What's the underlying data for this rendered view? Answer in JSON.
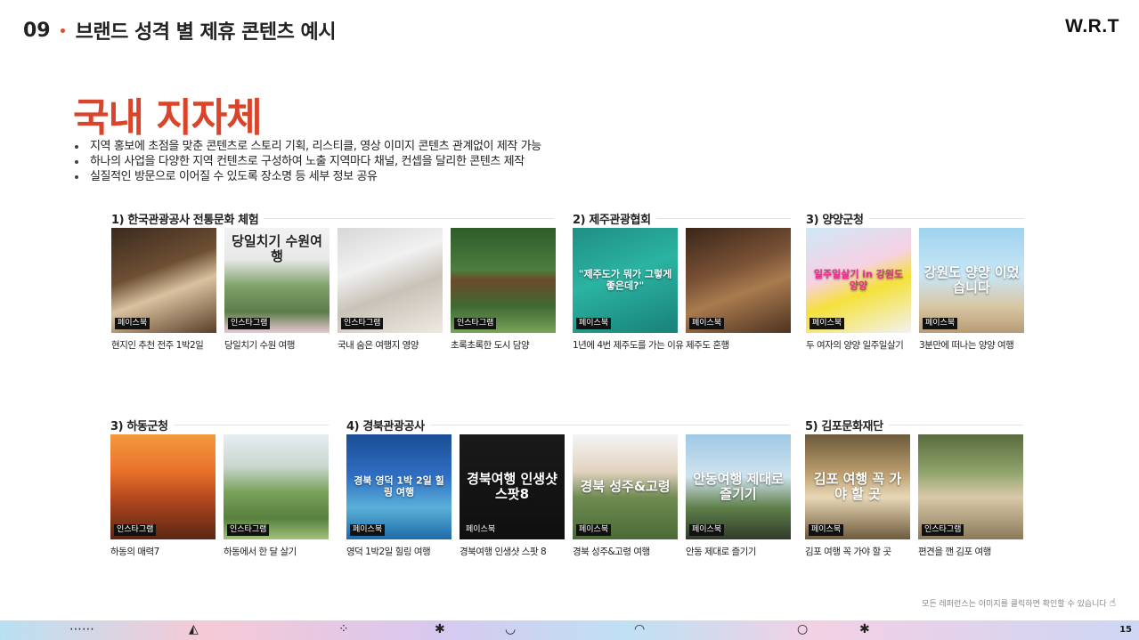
{
  "header": {
    "section_number": "09",
    "section_title": "브랜드 성격 별 제휴 콘텐츠 예시",
    "logo": "W.R.T"
  },
  "main_title": "국내 지자체",
  "bullets": [
    "지역 홍보에 초점을 맞춘 콘텐츠로 스토리 기획, 리스티클, 영상 이미지 콘텐츠 관계없이 제작 가능",
    "하나의 사업을 다양한 지역 컨텐츠로 구성하여 노출 지역마다 채널, 컨셉을 달리한 콘텐츠 제작",
    "실질적인 방문으로 이어질 수 있도록 장소명 등 세부 정보 공유"
  ],
  "groups": [
    {
      "label": "1) 한국관광공사 전통문화 체험",
      "cards": [
        {
          "platform": "페이스북",
          "caption": "현지인 추천 전주 1박2일",
          "overlay": "",
          "bg": "linear-gradient(160deg,#3b2a1e 0%,#6e4f34 40%,#d9c2a0 60%,#5a3e28 100%)"
        },
        {
          "platform": "인스타그램",
          "caption": "당일치기 수원 여행",
          "overlay": "당일치기 수원여행",
          "bg": "linear-gradient(180deg,#f2f2f2 0%,#e8e8e8 30%,#7fa36a 55%,#5c7d4a 80%,#e7c7d3 100%)"
        },
        {
          "platform": "인스타그램",
          "caption": "국내 숨은 여행지 영양",
          "overlay": "",
          "bg": "linear-gradient(160deg,#d7d7d7 0%,#f1f1f1 35%,#c9c2b8 60%,#efe9e2 100%)"
        },
        {
          "platform": "인스타그램",
          "caption": "초록초록한 도시 담양",
          "overlay": "",
          "bg": "linear-gradient(180deg,#2f5b2a 0%,#4e7d3e 40%,#6b4a2b 50%,#3f6a33 75%,#7aa35a 100%)"
        }
      ]
    },
    {
      "label": "2) 제주관광협회",
      "cards": [
        {
          "platform": "페이스북",
          "caption": "1년에 4번 제주도를 가는 이유",
          "overlay": "\"제주도가 뭐가 그렇게 좋은데?\"",
          "bg": "linear-gradient(160deg,#1f8f84 0%,#2bb3a2 45%,#188178 100%)"
        },
        {
          "platform": "페이스북",
          "caption": "제주도 혼행",
          "overlay": "",
          "bg": "linear-gradient(160deg,#3a2618 0%,#7a5236 40%,#a97b4f 60%,#4e3220 100%)"
        }
      ]
    },
    {
      "label": "3) 양양군청",
      "cards": [
        {
          "platform": "페이스북",
          "caption": "두 여자의 양양 일주일살기",
          "overlay": "일주일살기 in 강원도 양양",
          "bg": "linear-gradient(160deg,#cfe8f6 0%,#f6d1e4 40%,#f5e13c 60%,#f2f2f2 100%)"
        },
        {
          "platform": "페이스북",
          "caption": "3분만에 떠나는 양양 여행",
          "overlay": "강원도 양양 이었습니다",
          "bg": "linear-gradient(180deg,#9fd3ee 0%,#c7e6f5 45%,#d9c6a3 75%,#b79b74 100%)"
        }
      ]
    },
    {
      "label": "3) 하동군청",
      "cards": [
        {
          "platform": "인스타그램",
          "caption": "하동의 매력7",
          "overlay": "",
          "bg": "linear-gradient(180deg,#f39a3e 0%,#e9712b 35%,#b6491f 60%,#5a2614 100%)"
        },
        {
          "platform": "인스타그램",
          "caption": "하동에서 한 달 살기",
          "overlay": "",
          "bg": "linear-gradient(180deg,#e7eef2 0%,#c9d7cf 30%,#7aa25a 55%,#577f3e 80%,#a3c27c 100%)"
        }
      ]
    },
    {
      "label": "4) 경북관광공사",
      "cards": [
        {
          "platform": "페이스북",
          "caption": "영덕 1박2일 힐링 여행",
          "overlay": "경북 영덕 1박 2일 힐링 여행",
          "bg": "linear-gradient(180deg,#1b4d96 0%,#2f6fc4 40%,#5ab0d8 70%,#1d6aa8 100%)"
        },
        {
          "platform": "페이스북",
          "caption": "경북여행 인생샷 스팟 8",
          "overlay": "경북여행 인생샷 스팟8",
          "bg": "linear-gradient(180deg,#1a1a1a 0%,#0f0f0f 100%)"
        },
        {
          "platform": "페이스북",
          "caption": "경북 성주&고령 여행",
          "overlay": "경북 성주&고령",
          "bg": "linear-gradient(180deg,#f4f4f4 0%,#e2d3c0 35%,#6f8b52 60%,#4a6a36 100%)"
        },
        {
          "platform": "페이스북",
          "caption": "안동 제대로 즐기기",
          "overlay": "안동여행 제대로 즐기기",
          "bg": "linear-gradient(180deg,#9fc8e6 0%,#cfe3ef 40%,#5f7f4a 70%,#2f3b2a 100%)"
        }
      ]
    },
    {
      "label": "5) 김포문화재단",
      "cards": [
        {
          "platform": "페이스북",
          "caption": "김포 여행 꼭 가야 할 곳",
          "overlay": "김포 여행 꼭 가야 할 곳",
          "bg": "linear-gradient(180deg,#6b5a3b 0%,#b79a6b 35%,#e8d7b6 60%,#6e5a3c 100%)"
        },
        {
          "platform": "인스타그램",
          "caption": "편견을 깬 김포 여행",
          "overlay": "",
          "bg": "linear-gradient(180deg,#5a6b3e 0%,#8ea26a 35%,#d9c9a9 60%,#8a7a5a 100%)"
        }
      ]
    }
  ],
  "footer_note": "모든 레퍼런스는 이미지를 클릭하면 확인할 수 있습니다",
  "page_number": "15",
  "colors": {
    "accent": "#d9452a"
  }
}
